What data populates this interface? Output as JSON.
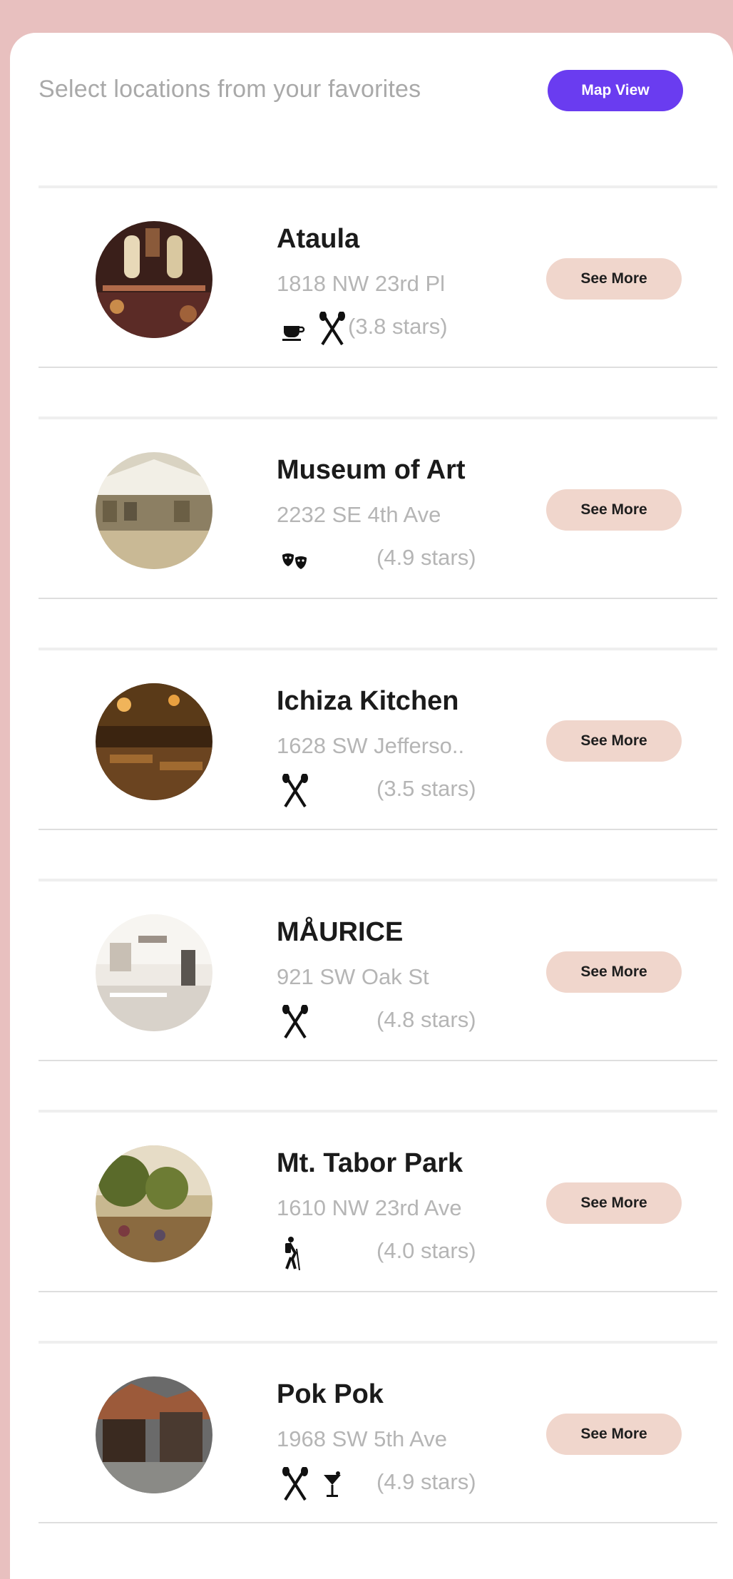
{
  "header": {
    "subtitle": "Select locations from your favorites",
    "map_view_label": "Map View"
  },
  "colors": {
    "background": "#e8c0bf",
    "accent": "#6a3cf0",
    "see_more_bg": "#f0d6cc"
  },
  "locations": [
    {
      "name": "Ataula",
      "address": "1818 NW 23rd Pl",
      "rating": "(3.8 stars)",
      "icons": [
        "coffee-icon",
        "utensils-icon"
      ],
      "button": "See More"
    },
    {
      "name": "Museum of Art",
      "address": "2232 SE 4th Ave",
      "rating": "(4.9 stars)",
      "icons": [
        "theater-masks-icon"
      ],
      "button": "See More"
    },
    {
      "name": "Ichiza Kitchen",
      "address": "1628 SW Jefferso..",
      "rating": "(3.5 stars)",
      "icons": [
        "utensils-icon"
      ],
      "button": "See More"
    },
    {
      "name": "MÅURICE",
      "address": "921 SW Oak St",
      "rating": "(4.8 stars)",
      "icons": [
        "utensils-icon"
      ],
      "button": "See More"
    },
    {
      "name": "Mt. Tabor Park",
      "address": "1610 NW 23rd Ave",
      "rating": "(4.0 stars)",
      "icons": [
        "hiker-icon"
      ],
      "button": "See More"
    },
    {
      "name": "Pok Pok",
      "address": "1968 SW 5th Ave",
      "rating": "(4.9 stars)",
      "icons": [
        "utensils-icon",
        "cocktail-icon"
      ],
      "button": "See More"
    }
  ]
}
